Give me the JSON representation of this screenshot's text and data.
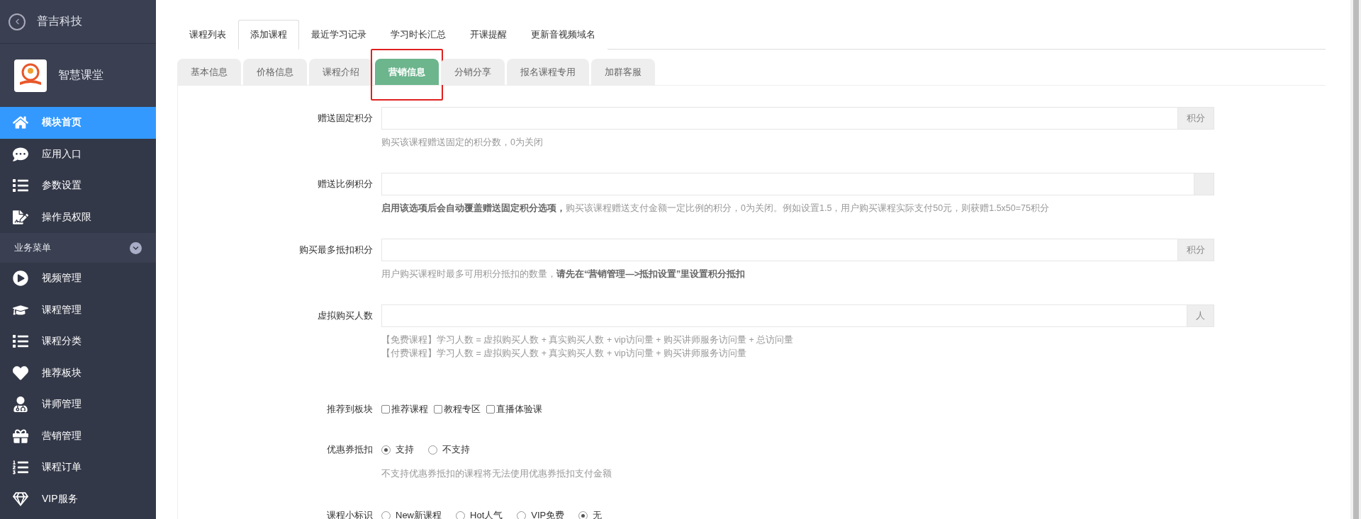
{
  "sidebar": {
    "back_title": "普吉科技",
    "app_name": "智慧课堂",
    "items": [
      {
        "label": "模块首页",
        "selected": true
      },
      {
        "label": "应用入口",
        "selected": false
      },
      {
        "label": "参数设置",
        "selected": false
      },
      {
        "label": "操作员权限",
        "selected": false
      }
    ],
    "section": {
      "title": "业务菜单",
      "expanded": true
    },
    "section_items": [
      {
        "label": "视频管理",
        "selected": false
      },
      {
        "label": "课程管理",
        "selected": false
      },
      {
        "label": "课程分类",
        "selected": false
      },
      {
        "label": "推荐板块",
        "selected": false
      },
      {
        "label": "讲师管理",
        "selected": false
      },
      {
        "label": "营销管理",
        "selected": false
      },
      {
        "label": "课程订单",
        "selected": false
      },
      {
        "label": "VIP服务",
        "selected": false
      }
    ]
  },
  "tabs": [
    {
      "label": "课程列表",
      "selected": false
    },
    {
      "label": "添加课程",
      "selected": true
    },
    {
      "label": "最近学习记录",
      "selected": false
    },
    {
      "label": "学习时长汇总",
      "selected": false
    },
    {
      "label": "开课提醒",
      "selected": false
    },
    {
      "label": "更新音视频域名",
      "selected": false
    }
  ],
  "sub_tabs": [
    {
      "label": "基本信息",
      "selected": false,
      "highlighted": false
    },
    {
      "label": "价格信息",
      "selected": false,
      "highlighted": false
    },
    {
      "label": "课程介绍",
      "selected": false,
      "highlighted": false
    },
    {
      "label": "营销信息",
      "selected": true,
      "highlighted": true
    },
    {
      "label": "分销分享",
      "selected": false,
      "highlighted": false
    },
    {
      "label": "报名课程专用",
      "selected": false,
      "highlighted": false
    },
    {
      "label": "加群客服",
      "selected": false,
      "highlighted": false
    }
  ],
  "form": [
    {
      "kind": "input",
      "label": "赠送固定积分",
      "suffix": true,
      "suffix_text": "积分",
      "help": [
        "购买该课程赠送固定的积分数，0为关闭"
      ]
    },
    {
      "kind": "input",
      "label": "赠送比例积分",
      "suffix": true,
      "help": [
        "**启用该选项后会自动覆盖赠送固定积分选项，**购买该课程赠送支付金额一定比例的积分，0为关闭。例如设置1.5，用户购买课程实际支付50元，则获赠1.5x50=75积分"
      ]
    },
    {
      "kind": "input",
      "label": "购买最多抵扣积分",
      "suffix": true,
      "suffix_text": "积分",
      "help": [
        "用户购买课程时最多可用积分抵扣的数量，**请先在“营销管理—>抵扣设置”里设置积分抵扣**"
      ]
    },
    {
      "kind": "input",
      "label": "虚拟购买人数",
      "suffix": true,
      "suffix_text": "人",
      "help": [
        "【免费课程】学习人数 = 虚拟购买人数 + 真实购买人数 + vip访问量 + 购买讲师服务访问量 + 总访问量",
        "【付费课程】学习人数 = 虚拟购买人数 + 真实购买人数 + vip访问量 + 购买讲师服务访问量"
      ]
    },
    {
      "kind": "checkboxes",
      "label": "推荐到板块",
      "options": [
        {
          "label": "推荐课程",
          "checked": false
        },
        {
          "label": "教程专区",
          "checked": false
        },
        {
          "label": "直播体验课",
          "checked": false
        }
      ]
    },
    {
      "kind": "radios",
      "label": "优惠券抵扣",
      "options": [
        {
          "label": "支持",
          "selected": true
        },
        {
          "label": "不支持",
          "selected": false
        }
      ],
      "help": [
        "不支持优惠券抵扣的课程将无法使用优惠券抵扣支付金额"
      ]
    },
    {
      "kind": "radios",
      "label": "课程小标识",
      "options": [
        {
          "label": "New新课程",
          "selected": false
        },
        {
          "label": "Hot人气",
          "selected": false
        },
        {
          "label": "VIP免费",
          "selected": false
        },
        {
          "label": "无",
          "selected": true
        }
      ]
    }
  ]
}
